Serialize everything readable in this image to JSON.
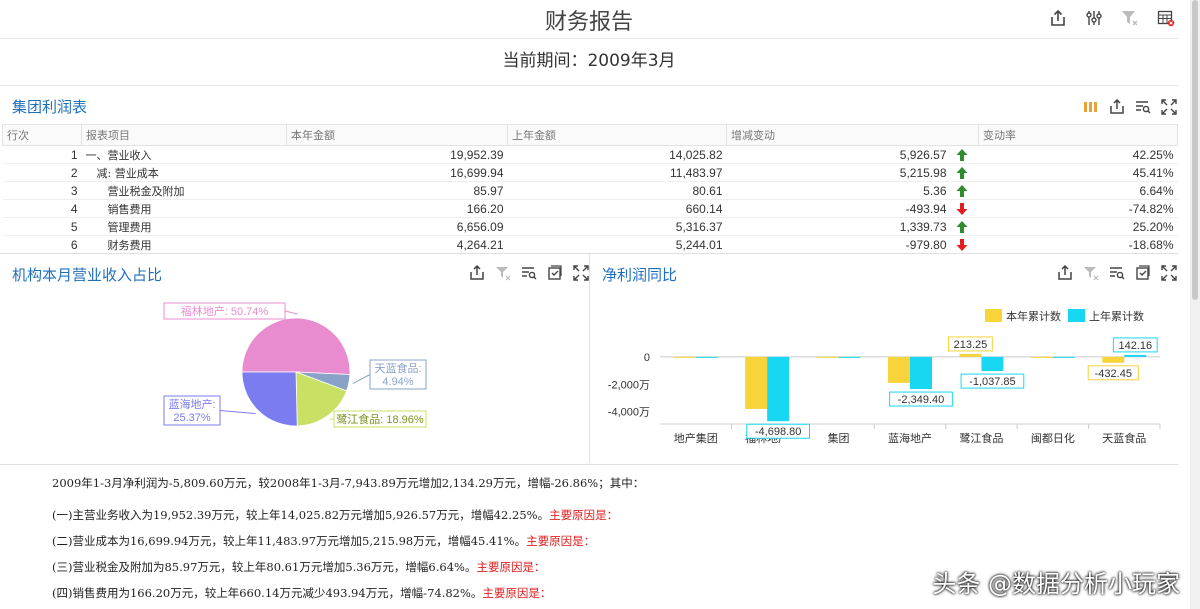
{
  "report": {
    "title": "财务报告",
    "period": "当前期间：2009年3月"
  },
  "toolbar": {
    "icons": [
      "export-icon",
      "settings-icon",
      "filter-clear-icon",
      "excel-icon"
    ]
  },
  "table_panel": {
    "title": "集团利润表",
    "columns": [
      "行次",
      "报表项目",
      "本年金额",
      "上年金额",
      "增减变动",
      "变动率"
    ],
    "rows": [
      {
        "no": "1",
        "item": "一、营业收入",
        "cur": "19,952.39",
        "prev": "14,025.82",
        "chg": "5,926.57",
        "dir": "up",
        "rate": "42.25%"
      },
      {
        "no": "2",
        "item": "　减: 营业成本",
        "cur": "16,699.94",
        "prev": "11,483.97",
        "chg": "5,215.98",
        "dir": "up",
        "rate": "45.41%"
      },
      {
        "no": "3",
        "item": "　　营业税金及附加",
        "cur": "85.97",
        "prev": "80.61",
        "chg": "5.36",
        "dir": "up",
        "rate": "6.64%"
      },
      {
        "no": "4",
        "item": "　　销售费用",
        "cur": "166.20",
        "prev": "660.14",
        "chg": "-493.94",
        "dir": "down",
        "rate": "-74.82%"
      },
      {
        "no": "5",
        "item": "　　管理费用",
        "cur": "6,656.09",
        "prev": "5,316.37",
        "chg": "1,339.73",
        "dir": "up",
        "rate": "25.20%"
      },
      {
        "no": "6",
        "item": "　　财务费用",
        "cur": "4,264.21",
        "prev": "5,244.01",
        "chg": "-979.80",
        "dir": "down",
        "rate": "-18.68%"
      }
    ]
  },
  "pie_panel": {
    "title": "机构本月营业收入占比"
  },
  "bar_panel": {
    "title": "净利润同比"
  },
  "chart_data": [
    {
      "type": "pie",
      "labels": [
        "福林地产",
        "天蓝食品",
        "鹭江食品",
        "蓝海地产"
      ],
      "values": [
        50.74,
        4.94,
        18.96,
        25.37
      ],
      "display_labels": [
        "福林地产: 50.74%",
        "天蓝食品:\n4.94%",
        "鹭江食品: 18.96%",
        "蓝海地产:\n25.37%"
      ],
      "colors": [
        "#e88ccf",
        "#8aa2c8",
        "#c8e063",
        "#7b7cf0"
      ]
    },
    {
      "type": "bar",
      "categories": [
        "地产集团",
        "福林地产",
        "集团",
        "蓝海地产",
        "鹭江食品",
        "闽都日化",
        "天蓝食品"
      ],
      "series": [
        {
          "name": "本年累计数",
          "color": "#f8d33a",
          "values": [
            -30,
            -3800,
            -20,
            -1900,
            213.25,
            -30,
            -432.45
          ]
        },
        {
          "name": "上年累计数",
          "color": "#17d7f2",
          "values": [
            -30,
            -4698.8,
            -20,
            -2349.4,
            -1037.85,
            -30,
            142.16
          ]
        }
      ],
      "data_labels": [
        {
          "series": 1,
          "index": 1,
          "text": "-4,698.80"
        },
        {
          "series": 1,
          "index": 3,
          "text": "-2,349.40"
        },
        {
          "series": 0,
          "index": 4,
          "text": "213.25"
        },
        {
          "series": 1,
          "index": 4,
          "text": "-1,037.85"
        },
        {
          "series": 0,
          "index": 6,
          "text": "-432.45"
        },
        {
          "series": 1,
          "index": 6,
          "text": "142.16"
        }
      ],
      "yticks": [
        "0",
        "-2,000万",
        "-4,000万"
      ],
      "ytick_values": [
        0,
        -2000,
        -4000
      ],
      "ylim": [
        -4900,
        500
      ],
      "legend": "top-right"
    }
  ],
  "analysis": {
    "summary": "2009年1-3月净利润为-5,809.60万元，较2008年1-3月-7,943.89万元增加2,134.29万元，增幅-26.86%；其中：",
    "lines": [
      {
        "text": "(一)主营业务收入为19,952.39万元，较上年14,025.82万元增加5,926.57万元，增幅42.25%。",
        "reason": "主要原因是："
      },
      {
        "text": "(二)营业成本为16,699.94万元，较上年11,483.97万元增加5,215.98万元，增幅45.41%。",
        "reason": "主要原因是："
      },
      {
        "text": "(三)营业税金及附加为85.97万元，较上年80.61万元增加5.36万元，增幅6.64%。",
        "reason": "主要原因是："
      },
      {
        "text": "(四)销售费用为166.20万元，较上年660.14万元减少493.94万元，增幅-74.82%。",
        "reason": "主要原因是："
      }
    ]
  },
  "watermark": "头条 @数据分析小玩家",
  "colors": {
    "accent": "#1f6fbf",
    "up": "#2e8b2e",
    "down": "#e02020",
    "reason": "#e02020"
  }
}
